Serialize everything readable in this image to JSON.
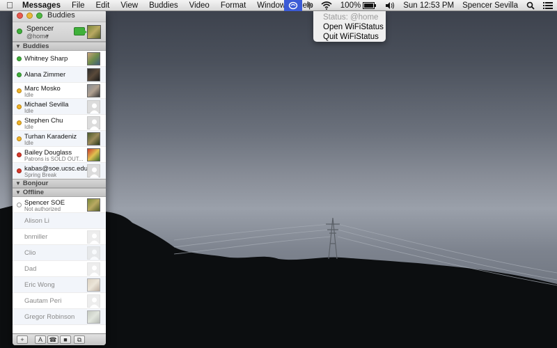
{
  "menubar": {
    "apple_icon": "apple-icon",
    "app_name": "Messages",
    "menus": [
      "File",
      "Edit",
      "View",
      "Buddies",
      "Video",
      "Format",
      "Window",
      "Help"
    ],
    "status_icons": [
      "wifistatus-icon",
      "bluetooth-icon",
      "wifi-icon",
      "volume-icon",
      "spotlight-icon",
      "notification-center-icon"
    ],
    "battery": "100%",
    "clock": "Sun 12:53 PM",
    "user": "Spencer Sevilla"
  },
  "dropdown": {
    "status": "Status: @home",
    "open": "Open WiFiStatus",
    "quit": "Quit WiFiStatus"
  },
  "window": {
    "title": "Buddies",
    "me": {
      "name": "Spencer",
      "status": "@home"
    },
    "groups": [
      {
        "name": "Buddies",
        "buddies": [
          {
            "name": "Whitney Sharp",
            "sub": "",
            "status": "green",
            "avatar": "photo"
          },
          {
            "name": "Alana Zimmer",
            "sub": "",
            "status": "green",
            "avatar": "photo"
          },
          {
            "name": "Marc Mosko",
            "sub": "Idle",
            "status": "yellow",
            "avatar": "photo"
          },
          {
            "name": "Michael Sevilla",
            "sub": "Idle",
            "status": "yellow",
            "avatar": "placeholder"
          },
          {
            "name": "Stephen Chu",
            "sub": "Idle",
            "status": "yellow",
            "avatar": "placeholder"
          },
          {
            "name": "Turhan Karadeniz",
            "sub": "Idle",
            "status": "yellow",
            "avatar": "photo"
          },
          {
            "name": "Bailey Douglass",
            "sub": "Patrons is SOLD OUT...",
            "status": "red",
            "avatar": "photo"
          },
          {
            "name": "kabas@soe.ucsc.edu",
            "sub": "Spring Break",
            "status": "red",
            "avatar": "placeholder"
          }
        ]
      },
      {
        "name": "Bonjour",
        "buddies": []
      },
      {
        "name": "Offline",
        "buddies": [
          {
            "name": "Spencer SOE",
            "sub": "Not authorized",
            "status": "gray",
            "avatar": "photo"
          },
          {
            "name": "Alison Li",
            "sub": "",
            "status": "none",
            "avatar": "none"
          },
          {
            "name": "bnmiller",
            "sub": "",
            "status": "none",
            "avatar": "placeholder"
          },
          {
            "name": "Clio",
            "sub": "",
            "status": "none",
            "avatar": "placeholder"
          },
          {
            "name": "Dad",
            "sub": "",
            "status": "none",
            "avatar": "placeholder"
          },
          {
            "name": "Eric Wong",
            "sub": "",
            "status": "none",
            "avatar": "photo"
          },
          {
            "name": "Gautam Peri",
            "sub": "",
            "status": "none",
            "avatar": "placeholder"
          },
          {
            "name": "Gregor Robinson",
            "sub": "",
            "status": "none",
            "avatar": "photo"
          }
        ]
      }
    ],
    "toolbar": [
      "add-icon",
      "text-chat-icon",
      "audio-chat-icon",
      "video-chat-icon",
      "screen-share-icon"
    ]
  }
}
